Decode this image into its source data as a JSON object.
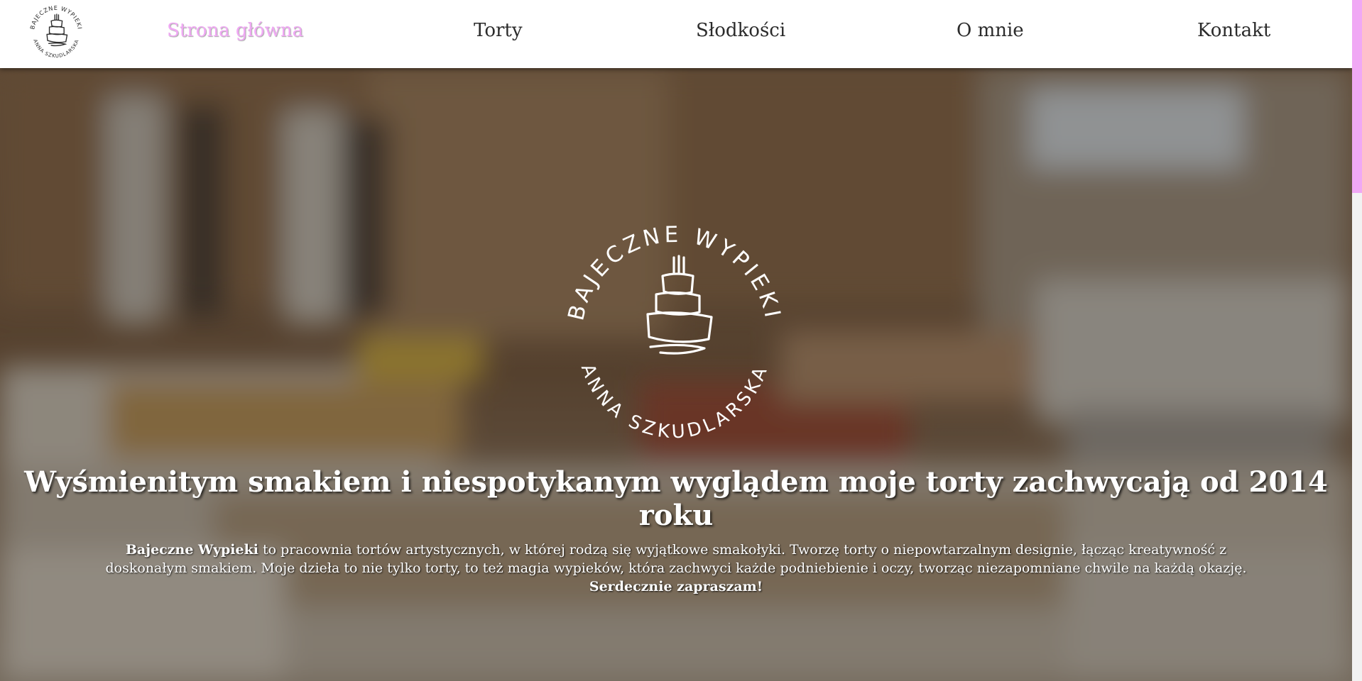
{
  "nav": {
    "logo_text_top": "BAJECZNE WYPIEKI",
    "logo_text_bottom": "ANNA SZKUDLARSKA",
    "items": [
      {
        "label": "Strona główna",
        "active": true
      },
      {
        "label": "Torty",
        "active": false
      },
      {
        "label": "Słodkości",
        "active": false
      },
      {
        "label": "O mnie",
        "active": false
      },
      {
        "label": "Kontakt",
        "active": false
      }
    ]
  },
  "hero": {
    "logo_text_top": "BAJECZNE WYPIEKI",
    "logo_text_bottom": "ANNA SZKUDLARSKA",
    "headline": "Wyśmienitym smakiem i niespotykanym wyglądem moje torty zachwycają od 2014 roku",
    "intro_brand": "Bajeczne Wypieki",
    "intro_text": " to pracownia tortów artystycznych, w której rodzą się wyjątkowe smakołyki. Tworzę torty o niepowtarzalnym designie, łącząc kreatywność z doskonałym smakiem. Moje dzieła to nie tylko torty, to też magia wypieków, która zachwyci każde podniebienie i oczy, tworząc niezapomniane chwile na każdą okazję.",
    "intro_closing": "Serdecznie zapraszam!"
  },
  "colors": {
    "accent": "#f0a8f4",
    "nav_bg": "#ffffff",
    "text_dark": "#2b2b2b"
  }
}
